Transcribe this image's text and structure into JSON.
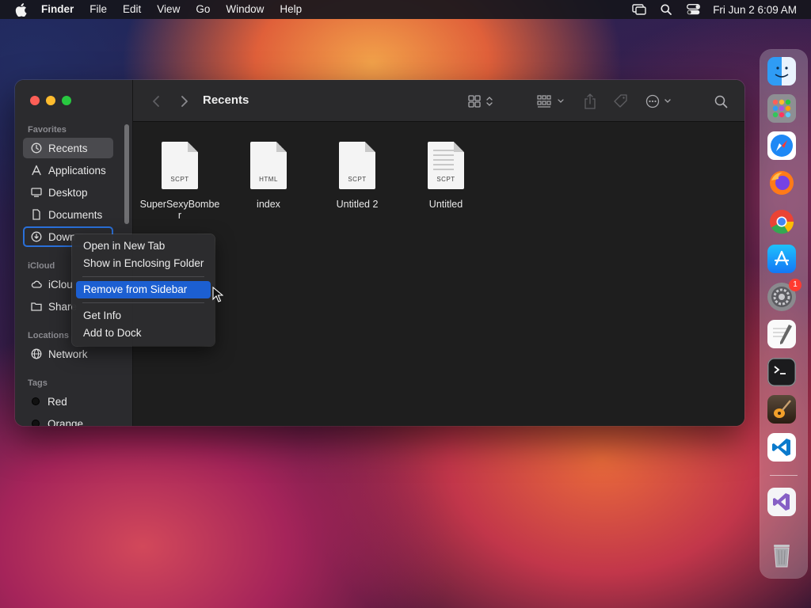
{
  "menubar": {
    "app_name": "Finder",
    "menus": [
      "File",
      "Edit",
      "View",
      "Go",
      "Window",
      "Help"
    ],
    "clock": "Fri Jun 2  6:09 AM",
    "status_icons": [
      "screen-mirroring-icon",
      "spotlight-search-icon",
      "control-center-icon"
    ]
  },
  "window": {
    "title": "Recents",
    "sidebar": {
      "favorites_label": "Favorites",
      "favorites": [
        {
          "label": "Recents",
          "icon": "clock-icon"
        },
        {
          "label": "Applications",
          "icon": "applications-icon"
        },
        {
          "label": "Desktop",
          "icon": "desktop-icon"
        },
        {
          "label": "Documents",
          "icon": "document-icon"
        },
        {
          "label": "Down",
          "icon": "downloads-icon"
        }
      ],
      "icloud_label": "iCloud",
      "icloud": [
        {
          "label": "iClou",
          "icon": "cloud-icon"
        },
        {
          "label": "Share",
          "icon": "shared-folder-icon"
        }
      ],
      "locations_label": "Locations",
      "locations": [
        {
          "label": "Network",
          "icon": "network-icon"
        }
      ],
      "tags_label": "Tags",
      "tags": [
        {
          "label": "Red"
        },
        {
          "label": "Orange"
        }
      ]
    },
    "files": [
      {
        "name": "SuperSexyBomber",
        "kind": "SCPT"
      },
      {
        "name": "index",
        "kind": "HTML"
      },
      {
        "name": "Untitled 2",
        "kind": "SCPT"
      },
      {
        "name": "Untitled",
        "kind": "SCPT"
      }
    ]
  },
  "context_menu": {
    "items": [
      {
        "label": "Open in New Tab"
      },
      {
        "label": "Show in Enclosing Folder"
      },
      {
        "label": "Remove from Sidebar",
        "highlighted": true
      },
      {
        "label": "Get Info"
      },
      {
        "label": "Add to Dock"
      }
    ]
  },
  "dock": {
    "apps": [
      "Finder",
      "Launchpad",
      "Safari",
      "Firefox",
      "Google Chrome",
      "App Store",
      "System Preferences",
      "TextEdit",
      "Terminal",
      "GarageBand",
      "Visual Studio Code",
      "Visual Studio",
      "Trash"
    ],
    "system_preferences_badge": "1"
  },
  "colors": {
    "selection_blue": "#1c5fd1",
    "focus_ring": "#2a70d9"
  }
}
